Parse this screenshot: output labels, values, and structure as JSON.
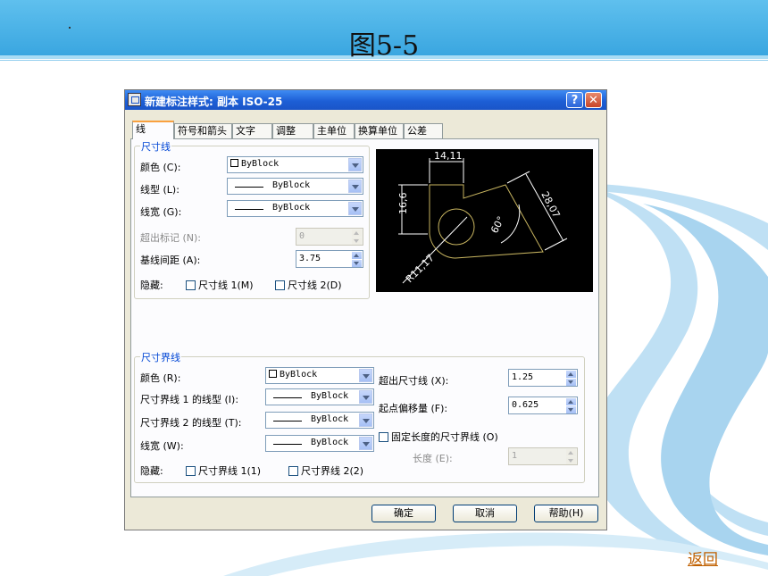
{
  "slide": {
    "title": "图5-5",
    "return_link": "返回"
  },
  "dialog": {
    "title": "新建标注样式: 副本 ISO-25",
    "tabs": [
      "线",
      "符号和箭头",
      "文字",
      "调整",
      "主单位",
      "换算单位",
      "公差"
    ],
    "dim_lines": {
      "group_title": "尺寸线",
      "color_label": "颜色 (C):",
      "color_value": "ByBlock",
      "linetype_label": "线型 (L):",
      "linetype_value": "ByBlock",
      "lineweight_label": "线宽 (G):",
      "lineweight_value": "ByBlock",
      "extend_label": "超出标记 (N):",
      "extend_value": "0",
      "spacing_label": "基线间距 (A):",
      "spacing_value": "3.75",
      "suppress_label": "隐藏:",
      "suppress_1": "尺寸线 1(M)",
      "suppress_2": "尺寸线 2(D)"
    },
    "ext_lines": {
      "group_title": "尺寸界线",
      "color_label": "颜色 (R):",
      "color_value": "ByBlock",
      "linetype1_label": "尺寸界线 1 的线型 (I):",
      "linetype1_value": "ByBlock",
      "linetype2_label": "尺寸界线 2 的线型 (T):",
      "linetype2_value": "ByBlock",
      "lineweight_label": "线宽 (W):",
      "lineweight_value": "ByBlock",
      "suppress_label": "隐藏:",
      "suppress_1": "尺寸界线 1(1)",
      "suppress_2": "尺寸界线 2(2)",
      "beyond_label": "超出尺寸线 (X):",
      "beyond_value": "1.25",
      "offset_label": "起点偏移量 (F):",
      "offset_value": "0.625",
      "fixed_label": "固定长度的尺寸界线 (O)",
      "length_label": "长度 (E):",
      "length_value": "1"
    },
    "preview": {
      "dim_top": "14,11",
      "dim_left": "16,6",
      "dim_right": "28,07",
      "dim_angle": "60°",
      "dim_radius": "R11,17"
    },
    "buttons": {
      "ok": "确定",
      "cancel": "取消",
      "help": "帮助(H)"
    },
    "titlebar_help": "?",
    "titlebar_close": "✕"
  },
  "colors": {
    "banner": "#3aa6e0",
    "dialog_title": "#1d5fd6",
    "preview_bg": "#000000",
    "preview_lines": "#c8b560",
    "group_title": "#0046d5"
  }
}
